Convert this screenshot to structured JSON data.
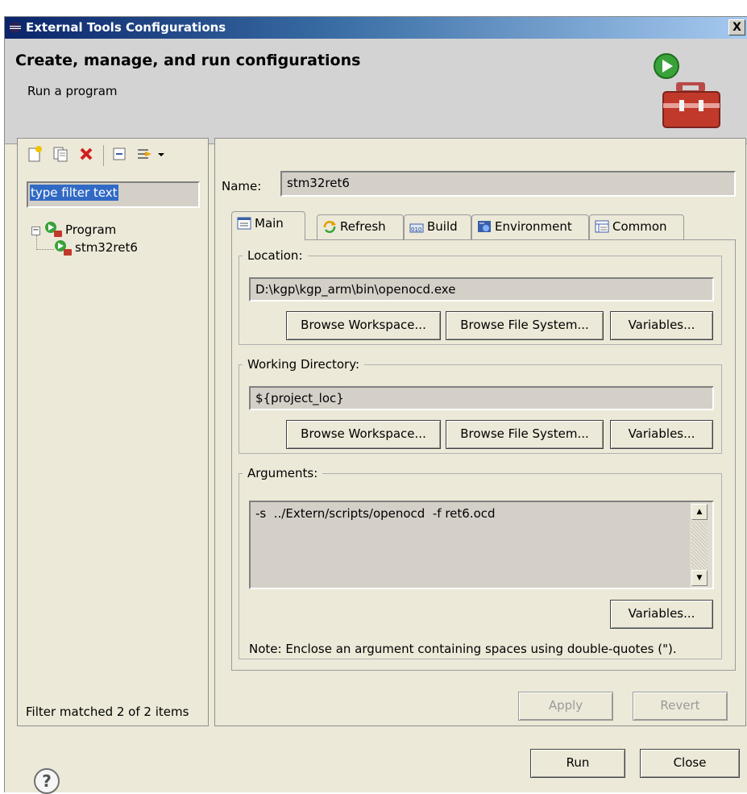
{
  "window": {
    "title": "External Tools Configurations",
    "close_label": "X"
  },
  "banner": {
    "heading": "Create, manage, and run configurations",
    "subheading": "Run a program"
  },
  "left": {
    "filter_placeholder": "type filter text",
    "tree": {
      "category": "Program",
      "expander": "−",
      "items": [
        "stm32ret6"
      ]
    },
    "status": "Filter matched 2 of 2 items"
  },
  "config": {
    "name_label": "Name:",
    "name_value": "stm32ret6",
    "tabs": [
      {
        "label": "Main",
        "icon": "main-tab-icon"
      },
      {
        "label": "Refresh",
        "icon": "refresh-icon"
      },
      {
        "label": "Build",
        "icon": "build-icon"
      },
      {
        "label": "Environment",
        "icon": "environment-icon"
      },
      {
        "label": "Common",
        "icon": "common-icon"
      }
    ],
    "location": {
      "label": "Location:",
      "value": "D:\\kgp\\kgp_arm\\bin\\openocd.exe",
      "browse_workspace": "Browse Workspace...",
      "browse_file_system": "Browse File System...",
      "variables": "Variables..."
    },
    "working_directory": {
      "label": "Working Directory:",
      "value": "${project_loc}",
      "browse_workspace": "Browse Workspace...",
      "browse_file_system": "Browse File System...",
      "variables": "Variables..."
    },
    "arguments": {
      "label": "Arguments:",
      "value": "-s  ../Extern/scripts/openocd  -f ret6.ocd",
      "variables": "Variables...",
      "note": "Note: Enclose an argument containing spaces using double-quotes (\")."
    },
    "apply": "Apply",
    "revert": "Revert"
  },
  "footer": {
    "help": "?",
    "run": "Run",
    "close": "Close"
  },
  "colors": {
    "titlebar_start": "#0a246a",
    "titlebar_end": "#a6caf0",
    "dialog_bg": "#ece9d8",
    "banner_bg": "#d3d3d3",
    "selection": "#316ac5"
  }
}
